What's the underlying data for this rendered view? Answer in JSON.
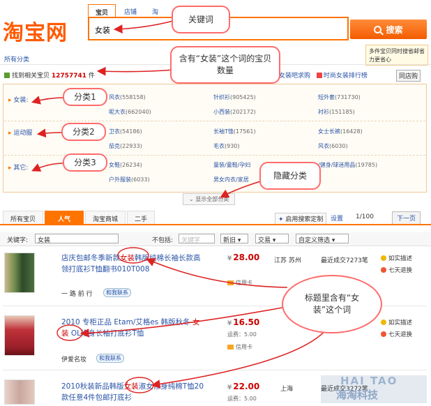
{
  "header": {
    "logo": "淘宝网",
    "tabs": [
      "宝贝",
      "店铺",
      "淘"
    ],
    "search_value": "女装",
    "search_button": "搜索",
    "all_categories": "所有分类",
    "tip": "多件宝贝同时搜省邮省力更省心"
  },
  "results": {
    "found_prefix": "找到相关宝贝",
    "count": "12757741",
    "suffix": "件",
    "rank_link": "女装吧求购",
    "rank_link2": "时尚女装排行榜",
    "rank_button": "同店购"
  },
  "categories": {
    "rows": [
      {
        "title": "女装:",
        "items": [
          {
            "name": "风衣",
            "count": "(558158)"
          },
          {
            "name": "针织衫",
            "count": "(905425)"
          },
          {
            "name": "短外套",
            "count": "(731730)"
          },
          {
            "name": "呢大衣",
            "count": "(662040)"
          },
          {
            "name": "小西装",
            "count": "(202172)"
          },
          {
            "name": "衬衫",
            "count": "(151185)"
          }
        ]
      },
      {
        "title": "运动服",
        "items": [
          {
            "name": "卫衣",
            "count": "(54186)"
          },
          {
            "name": "长袖T恤",
            "count": "(17561)"
          },
          {
            "name": "女士长裤",
            "count": "(16428)"
          },
          {
            "name": "茄克",
            "count": "(22933)"
          },
          {
            "name": "毛衣",
            "count": "(930)"
          },
          {
            "name": "风衣",
            "count": "(6030)"
          }
        ]
      },
      {
        "title": "其它:",
        "items": [
          {
            "name": "女鞋",
            "count": "(26234)"
          },
          {
            "name": "童装/童鞋/孕妇",
            "count": ""
          },
          {
            "name": "/健身/球迷用品",
            "count": "(19785)"
          },
          {
            "name": "户外服装",
            "count": "(6033)"
          },
          {
            "name": "男女内衣/家居",
            "count": ""
          }
        ]
      }
    ],
    "show_all": "显示全部分类"
  },
  "tabs2": [
    "所有宝贝",
    "人气",
    "淘宝商城",
    "二手"
  ],
  "toolbar": {
    "custom": "启用搜索定制",
    "settings": "设置",
    "page": "1/100",
    "next": "下一页"
  },
  "filter": {
    "keyword_label": "关键字:",
    "keyword_value": "女装",
    "exclude_label": "不包括:",
    "exclude_placeholder": "关键字",
    "select_new": "新旧",
    "select_trade": "交易",
    "select_custom": "自定义筛选"
  },
  "listings": [
    {
      "title_a": "店庆包邮冬季新款",
      "title_hl": "女装",
      "title_b": "韩版纯棉长袖长款高领打底衫T恤翻书010T008",
      "seller": "一 路 前 行",
      "price": "28.00",
      "fee": "",
      "card": "信用卡",
      "location": "江苏 苏州",
      "sold": "最近成交7273笔",
      "svc1": "如实描述",
      "svc2": "七天退换"
    },
    {
      "title_a": "2010 专柜正品 Etam/艾格es 韩版秋冬 ",
      "title_hl": "女装",
      "title_b": " OL修身长袖打底衫T恤",
      "seller": "伊爱名妆",
      "price": "16.50",
      "fee": "运费：5.00",
      "card": "信用卡",
      "location": "",
      "sold": "",
      "svc1": "如实描述",
      "svc2": "七天退换"
    },
    {
      "title_a": "2010秋装新品韩版",
      "title_hl": "女装",
      "title_b": "淑女修身纯棉T恤20款任意4件包邮打底衫",
      "seller": "",
      "price": "22.00",
      "fee": "运费：5.00",
      "card": "",
      "location": "上海",
      "sold": "最近成交3272笔",
      "svc1": "",
      "svc2": ""
    }
  ],
  "annotations": {
    "keyword": "关键词",
    "count": "含有“女装”这个词的宝贝数量",
    "cat1": "分类1",
    "cat2": "分类2",
    "cat3": "分类3",
    "hidden": "隐藏分类",
    "title_note": "标题里含有“女装”这个词"
  },
  "watermark": {
    "line1": "HAI TAO",
    "line2": "海淘科技"
  },
  "colors": {
    "accent": "#ff7300",
    "link": "#2953a6",
    "price": "#cc0000",
    "annotation": "#ff6b6b"
  }
}
